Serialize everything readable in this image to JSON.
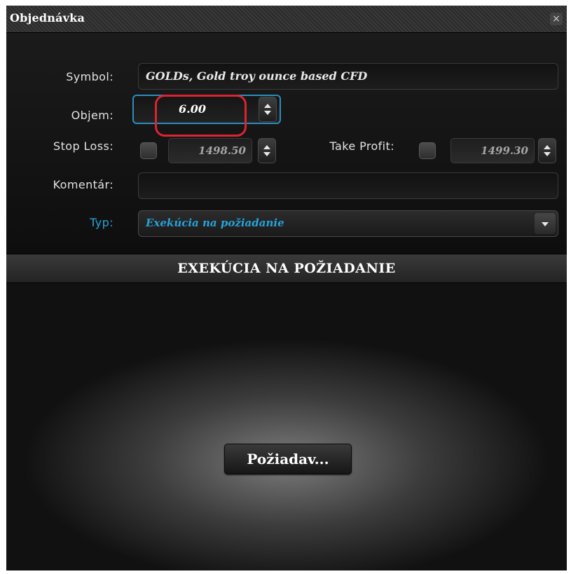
{
  "window": {
    "title": "Objednávka",
    "close_glyph": "×"
  },
  "form": {
    "symbol_label": "Symbol:",
    "symbol_value": "GOLDs, Gold troy ounce based CFD",
    "volume_label": "Objem:",
    "volume_value": "6.00",
    "stop_loss_label": "Stop Loss:",
    "stop_loss_value": "1498.50",
    "take_profit_label": "Take Profit:",
    "take_profit_value": "1499.30",
    "comment_label": "Komentár:",
    "comment_value": "",
    "type_label": "Typ:",
    "type_value": "Exekúcia na požiadanie"
  },
  "section": {
    "header": "EXEKÚCIA NA POŽIADANIE"
  },
  "actions": {
    "request_button": "Požiadav..."
  },
  "colors": {
    "accent_blue": "#27a3da",
    "highlight_red": "#d92433",
    "background": "#111111",
    "text": "#e2e2e2"
  },
  "icons": {
    "close": "close-icon",
    "spinner": "spinner-arrows-icon",
    "dropdown": "chevron-down-icon"
  }
}
